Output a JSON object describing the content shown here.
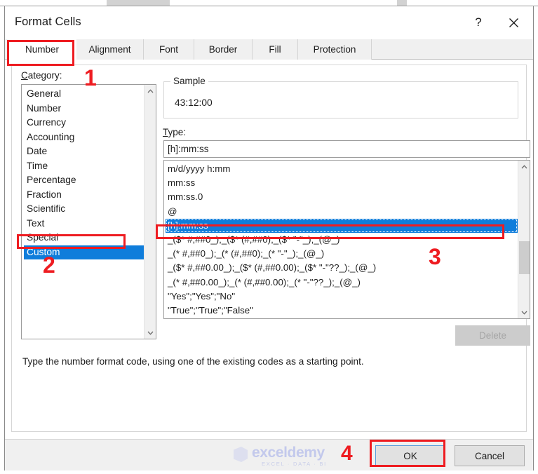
{
  "window": {
    "title": "Format Cells",
    "help_icon": "question-mark-icon",
    "close_icon": "close-icon"
  },
  "tabs": [
    {
      "label": "Number",
      "active": true
    },
    {
      "label": "Alignment",
      "active": false
    },
    {
      "label": "Font",
      "active": false
    },
    {
      "label": "Border",
      "active": false
    },
    {
      "label": "Fill",
      "active": false
    },
    {
      "label": "Protection",
      "active": false
    }
  ],
  "category": {
    "label_prefix": "C",
    "label_rest": "ategory:",
    "items": [
      "General",
      "Number",
      "Currency",
      "Accounting",
      "Date",
      "Time",
      "Percentage",
      "Fraction",
      "Scientific",
      "Text",
      "Special",
      "Custom"
    ],
    "selected": "Custom",
    "scroll_up_icon": "chevron-up-icon",
    "scroll_down_icon": "chevron-down-icon"
  },
  "sample": {
    "legend": "Sample",
    "value": "43:12:00"
  },
  "type": {
    "label_prefix": "T",
    "label_rest": "ype:",
    "input_value": "[h]:mm:ss",
    "input_placeholder": "",
    "items": [
      "m/d/yyyy h:mm",
      "mm:ss",
      "mm:ss.0",
      "@",
      "[h]:mm:ss",
      "_($* #,##0_);_($* (#,##0);_($* \"-\"_);_(@_)",
      "_(* #,##0_);_(* (#,##0);_(* \"-\"_);_(@_)",
      "_($* #,##0.00_);_($* (#,##0.00);_($* \"-\"??_);_(@_)",
      "_(* #,##0.00_);_(* (#,##0.00);_(* \"-\"??_);_(@_)",
      "\"Yes\";\"Yes\";\"No\"",
      "\"True\";\"True\";\"False\""
    ],
    "selected": "[h]:mm:ss",
    "scroll_up_icon": "chevron-up-icon",
    "scroll_down_icon": "chevron-down-icon"
  },
  "delete_button": {
    "label": "Delete",
    "enabled": false
  },
  "description": "Type the number format code, using one of the existing codes as a starting point.",
  "footer": {
    "ok_label": "OK",
    "cancel_label": "Cancel"
  },
  "watermark": {
    "main": "exceldemy",
    "sub": "EXCEL · DATA · BI"
  },
  "annotations": [
    {
      "id": "step-1",
      "number": "1",
      "target": "number-tab"
    },
    {
      "id": "step-2",
      "number": "2",
      "target": "category-custom-item"
    },
    {
      "id": "step-3",
      "number": "3",
      "target": "type-selected-item"
    },
    {
      "id": "step-4",
      "number": "4",
      "target": "ok-button"
    }
  ],
  "colors": {
    "annotation_red": "#ee1c21",
    "selection_blue": "#0f7ddb",
    "dialog_bg": "#ffffff",
    "footer_bg": "#f0f0f0"
  }
}
